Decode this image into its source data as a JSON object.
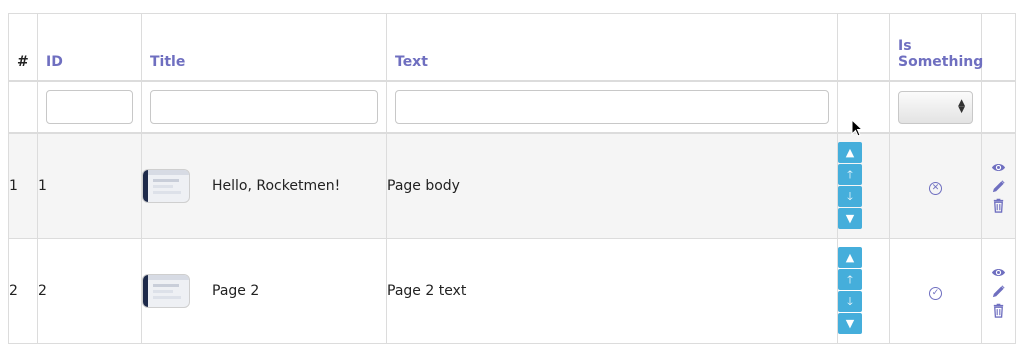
{
  "table": {
    "headers": {
      "num": "#",
      "id": "ID",
      "title": "Title",
      "text": "Text",
      "sort": "",
      "is_something_line1": "Is",
      "is_something_line2": "Something",
      "actions": ""
    },
    "rows": [
      {
        "num": "1",
        "id": "1",
        "title": "Hello, Rocketmen!",
        "text": "Page body",
        "is_something": false,
        "status_icon": "x-circle-icon"
      },
      {
        "num": "2",
        "id": "2",
        "title": "Page 2",
        "text": "Page 2 text",
        "is_something": true,
        "status_icon": "check-circle-icon"
      }
    ]
  },
  "icons": {
    "sort_first": "chevron-up-icon",
    "sort_up": "arrow-up-icon",
    "sort_down": "arrow-down-icon",
    "sort_last": "chevron-down-icon",
    "view": "eye-icon",
    "edit": "pencil-icon",
    "delete": "trash-icon"
  },
  "colors": {
    "header_link": "#6f6fc0",
    "sort_button": "#45aedb",
    "row_odd_bg": "#f5f5f5",
    "border": "#dcdcdc"
  }
}
